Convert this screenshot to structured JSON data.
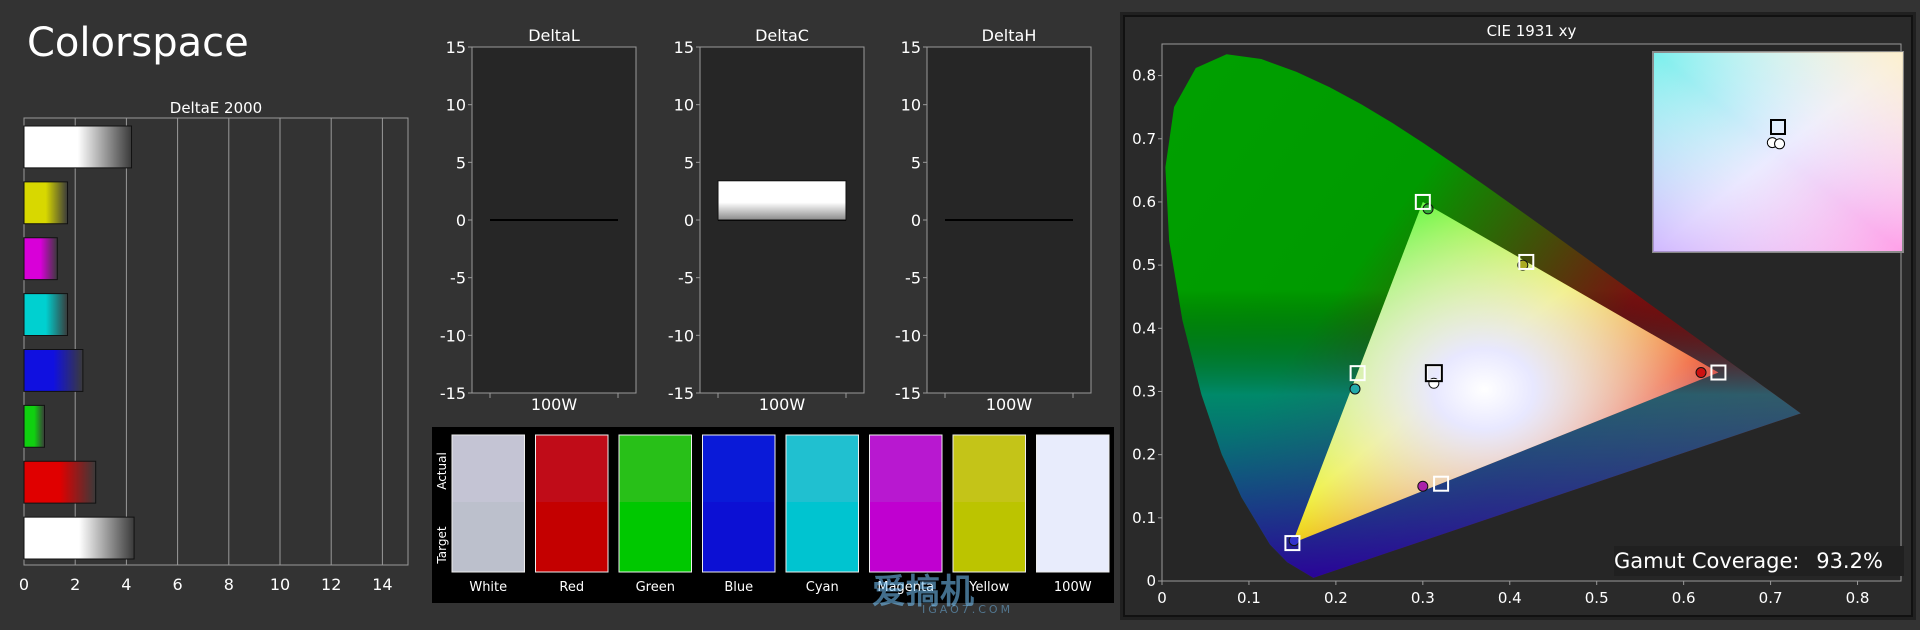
{
  "page": {
    "title": "Colorspace"
  },
  "chart_data": [
    {
      "id": "deltae",
      "type": "bar",
      "orientation": "horizontal",
      "title": "DeltaE 2000",
      "categories": [
        "White",
        "Yellow",
        "Magenta",
        "Cyan",
        "Blue",
        "Green",
        "Red",
        "100W"
      ],
      "values": [
        4.2,
        1.7,
        1.3,
        1.7,
        2.3,
        0.8,
        2.8,
        4.3
      ],
      "bar_colors": [
        "#ffffff",
        "#d8d800",
        "#d800d8",
        "#00d0d0",
        "#1010e0",
        "#10d010",
        "#e00000",
        "#ffffff"
      ],
      "xlim": [
        0,
        15
      ],
      "xticks": [
        "0",
        "2",
        "4",
        "6",
        "8",
        "10",
        "12",
        "14"
      ],
      "grid": true
    },
    {
      "id": "deltal",
      "type": "bar",
      "title": "DeltaL",
      "categories": [
        "100W"
      ],
      "values": [
        0
      ],
      "ylim": [
        -15,
        15
      ],
      "yticks": [
        "15",
        "10",
        "5",
        "0",
        "-5",
        "-10",
        "-15"
      ]
    },
    {
      "id": "deltac",
      "type": "bar",
      "title": "DeltaC",
      "categories": [
        "100W"
      ],
      "values": [
        3.4
      ],
      "ylim": [
        -15,
        15
      ],
      "yticks": [
        "15",
        "10",
        "5",
        "0",
        "-5",
        "-10",
        "-15"
      ]
    },
    {
      "id": "deltah",
      "type": "bar",
      "title": "DeltaH",
      "categories": [
        "100W"
      ],
      "values": [
        0
      ],
      "ylim": [
        -15,
        15
      ],
      "yticks": [
        "15",
        "10",
        "5",
        "0",
        "-5",
        "-10",
        "-15"
      ]
    },
    {
      "id": "swatches",
      "type": "table",
      "row_labels": [
        "Actual",
        "Target"
      ],
      "columns": [
        {
          "name": "White",
          "actual": "#c4c4d4",
          "target": "#bcc0cc"
        },
        {
          "name": "Red",
          "actual": "#c00c18",
          "target": "#c40000"
        },
        {
          "name": "Green",
          "actual": "#28c018",
          "target": "#00c800"
        },
        {
          "name": "Blue",
          "actual": "#0a1ad8",
          "target": "#0c10d4"
        },
        {
          "name": "Cyan",
          "actual": "#20c0d0",
          "target": "#00c4d0"
        },
        {
          "name": "Magenta",
          "actual": "#b818d0",
          "target": "#c000d0"
        },
        {
          "name": "Yellow",
          "actual": "#c4c418",
          "target": "#bcc400"
        },
        {
          "name": "100W",
          "actual": "#e8ecfc",
          "target": "#e8ecfc"
        }
      ]
    },
    {
      "id": "cie",
      "type": "scatter",
      "title": "CIE 1931 xy",
      "xlim": [
        0,
        0.85
      ],
      "ylim": [
        0,
        0.85
      ],
      "xticks": [
        "0",
        "0.1",
        "0.2",
        "0.3",
        "0.4",
        "0.5",
        "0.6",
        "0.7",
        "0.8"
      ],
      "yticks": [
        "0",
        "0.1",
        "0.2",
        "0.3",
        "0.4",
        "0.5",
        "0.6",
        "0.7",
        "0.8"
      ],
      "target_points": [
        {
          "name": "Red",
          "x": 0.64,
          "y": 0.33
        },
        {
          "name": "Green",
          "x": 0.3,
          "y": 0.6
        },
        {
          "name": "Blue",
          "x": 0.15,
          "y": 0.06
        },
        {
          "name": "Cyan",
          "x": 0.225,
          "y": 0.329
        },
        {
          "name": "Magenta",
          "x": 0.321,
          "y": 0.154
        },
        {
          "name": "Yellow",
          "x": 0.419,
          "y": 0.505
        },
        {
          "name": "White",
          "x": 0.3127,
          "y": 0.329
        }
      ],
      "measured_points": [
        {
          "name": "Red",
          "x": 0.62,
          "y": 0.33,
          "color": "#cc1111"
        },
        {
          "name": "Green",
          "x": 0.306,
          "y": 0.589,
          "color": "#33aa33"
        },
        {
          "name": "Blue",
          "x": 0.152,
          "y": 0.064,
          "color": "#3333cc"
        },
        {
          "name": "Cyan",
          "x": 0.222,
          "y": 0.304,
          "color": "#22aaaa"
        },
        {
          "name": "Magenta",
          "x": 0.3,
          "y": 0.15,
          "color": "#aa22aa"
        },
        {
          "name": "Yellow",
          "x": 0.415,
          "y": 0.5,
          "color": "#aaaa22"
        },
        {
          "name": "White",
          "x": 0.3127,
          "y": 0.313,
          "color": "#ffffff"
        }
      ],
      "inset": {
        "target": {
          "x": 0.3127,
          "y": 0.329
        },
        "measured": [
          {
            "x": 0.308,
            "y": 0.316
          },
          {
            "x": 0.314,
            "y": 0.315
          }
        ]
      },
      "gamut_coverage_label": "Gamut Coverage:",
      "gamut_coverage_value": "93.2%"
    }
  ],
  "watermark": {
    "text": "爱搞机",
    "sub": "IGAO7.COM"
  }
}
